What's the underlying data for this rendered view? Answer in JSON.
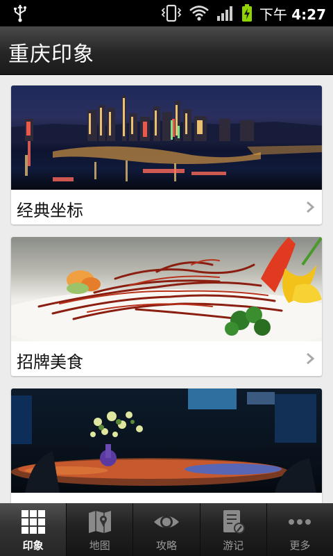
{
  "status_bar": {
    "time_prefix": "下午",
    "time": "4:27",
    "icons": [
      "usb-icon",
      "vibrate-icon",
      "wifi-icon",
      "signal-icon",
      "battery-charging-icon"
    ]
  },
  "app_bar": {
    "title": "重庆印象"
  },
  "cards": [
    {
      "label": "经典坐标",
      "image": "chongqing-night-skyline"
    },
    {
      "label": "招牌美食",
      "image": "spicy-beef-dish"
    },
    {
      "label": "",
      "image": "bar-table-with-flowers"
    }
  ],
  "bottom_nav": {
    "active_index": 0,
    "tabs": [
      {
        "label": "印象",
        "icon": "grid-icon"
      },
      {
        "label": "地图",
        "icon": "map-icon"
      },
      {
        "label": "攻略",
        "icon": "eye-icon"
      },
      {
        "label": "游记",
        "icon": "journal-icon"
      },
      {
        "label": "更多",
        "icon": "more-icon"
      }
    ]
  },
  "colors": {
    "status_bar": "#000000",
    "title_bar": "#262626",
    "background": "#ececec",
    "nav_active_text": "#ffffff",
    "nav_text": "#9a9a9a"
  }
}
